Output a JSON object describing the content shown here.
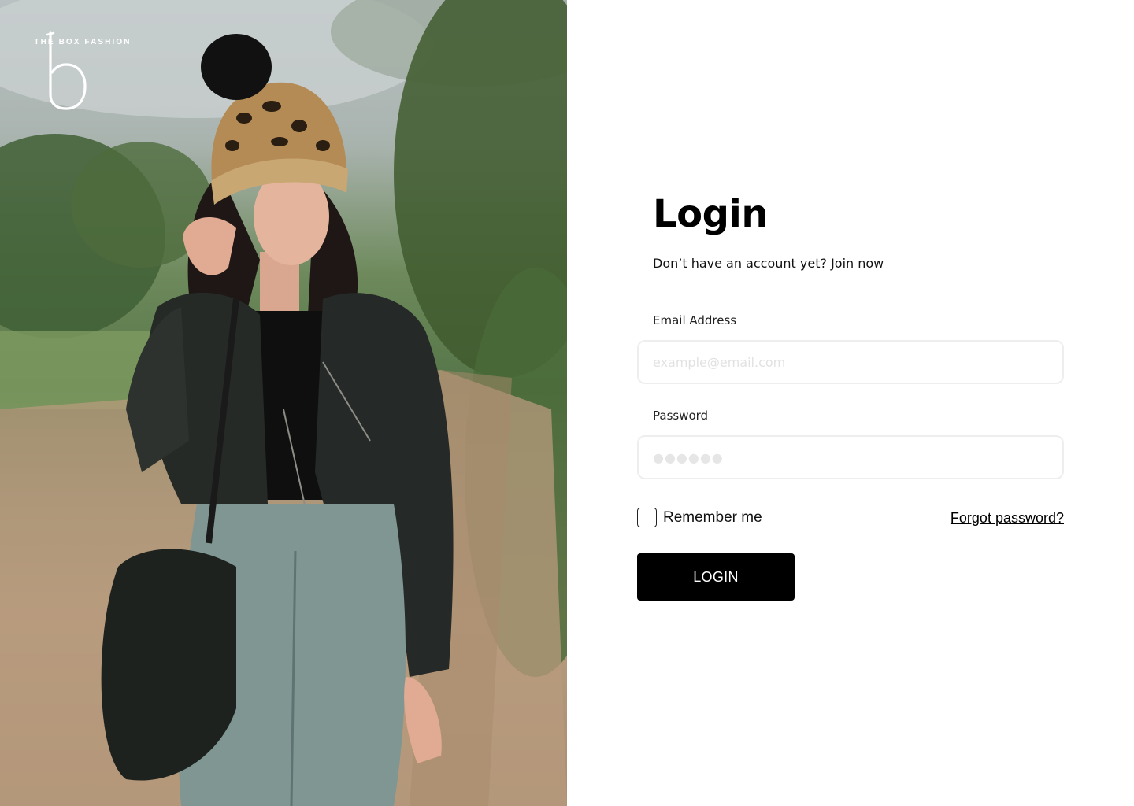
{
  "brand": {
    "logo_letter": "b",
    "name": "THE BOX FASHION"
  },
  "hero": {
    "image": "fashion-model-photo"
  },
  "login": {
    "title": "Login",
    "subtitle": "Don’t have an account yet? Join now",
    "email": {
      "label": "Email Address",
      "placeholder": "example@email.com",
      "value": ""
    },
    "password": {
      "label": "Password",
      "placeholder": "●●●●●●",
      "value": ""
    },
    "remember_label": "Remember me",
    "remember_checked": false,
    "forgot_label": "Forgot password?",
    "submit_label": "LOGIN"
  },
  "colors": {
    "primary": "#000000",
    "background": "#ffffff",
    "input_border": "#eeeeee",
    "placeholder": "#e2e2e2"
  }
}
